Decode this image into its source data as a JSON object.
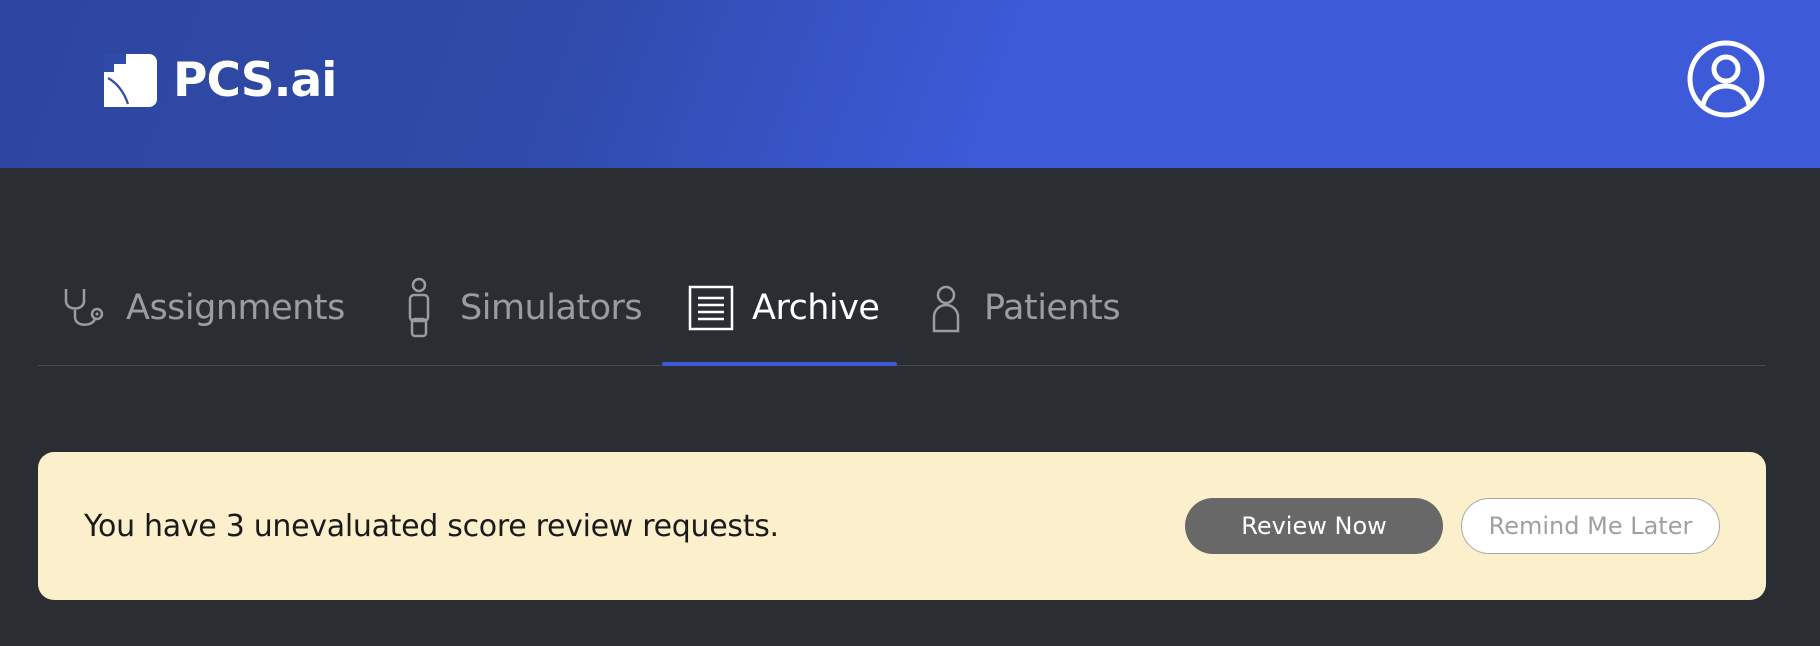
{
  "header": {
    "brand": "PCS.ai",
    "logo_icon": "pcs-logo-mark",
    "profile_icon": "user-circle-icon",
    "colors": {
      "gradient_start": "#2d46a0",
      "gradient_end": "#3d5ad8"
    }
  },
  "tabs": [
    {
      "label": "Assignments",
      "icon": "stethoscope-icon",
      "active": false
    },
    {
      "label": "Simulators",
      "icon": "mannequin-icon",
      "active": false
    },
    {
      "label": "Archive",
      "icon": "document-list-icon",
      "active": true
    },
    {
      "label": "Patients",
      "icon": "person-icon",
      "active": false
    }
  ],
  "banner": {
    "message": "You have 3 unevaluated score review requests.",
    "review_button": "Review Now",
    "remind_button": "Remind Me Later",
    "background": "#fcefcc"
  },
  "theme": {
    "page_background": "#2a2d32",
    "accent": "#3d5ad8"
  }
}
